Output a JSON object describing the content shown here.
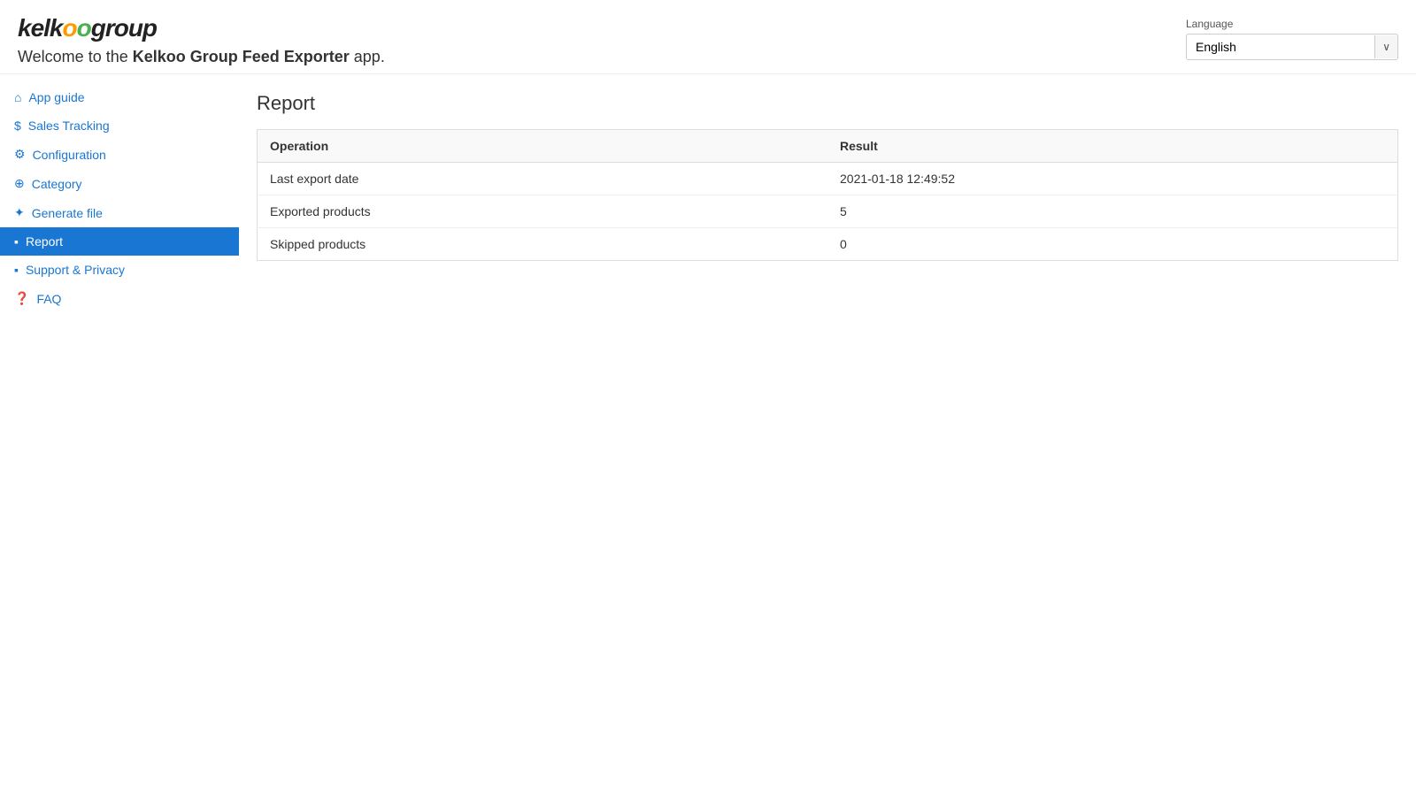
{
  "header": {
    "logo_part1": "kelk",
    "logo_o1": "o",
    "logo_o2": "o",
    "logo_part2": "group",
    "welcome_text": "Welcome to the ",
    "welcome_bold": "Kelkoo Group Feed Exporter",
    "welcome_suffix": " app."
  },
  "language": {
    "label": "Language",
    "selected": "English",
    "chevron": "∨"
  },
  "sidebar": {
    "items": [
      {
        "id": "app-guide",
        "label": "App guide",
        "icon": "⌂",
        "active": false
      },
      {
        "id": "sales-tracking",
        "label": "Sales Tracking",
        "icon": "$",
        "active": false
      },
      {
        "id": "configuration",
        "label": "Configuration",
        "icon": "⚙",
        "active": false
      },
      {
        "id": "category",
        "label": "Category",
        "icon": "⊕",
        "active": false
      },
      {
        "id": "generate-file",
        "label": "Generate file",
        "icon": "✦",
        "active": false
      },
      {
        "id": "report",
        "label": "Report",
        "icon": "▪",
        "active": true
      },
      {
        "id": "support-privacy",
        "label": "Support & Privacy",
        "icon": "▪",
        "active": false
      },
      {
        "id": "faq",
        "label": "FAQ",
        "icon": "❓",
        "active": false
      }
    ]
  },
  "main": {
    "report": {
      "title": "Report",
      "table": {
        "columns": [
          {
            "key": "operation",
            "label": "Operation"
          },
          {
            "key": "result",
            "label": "Result"
          }
        ],
        "rows": [
          {
            "operation": "Last export date",
            "result": "2021-01-18 12:49:52"
          },
          {
            "operation": "Exported products",
            "result": "5"
          },
          {
            "operation": "Skipped products",
            "result": "0"
          }
        ]
      }
    }
  }
}
